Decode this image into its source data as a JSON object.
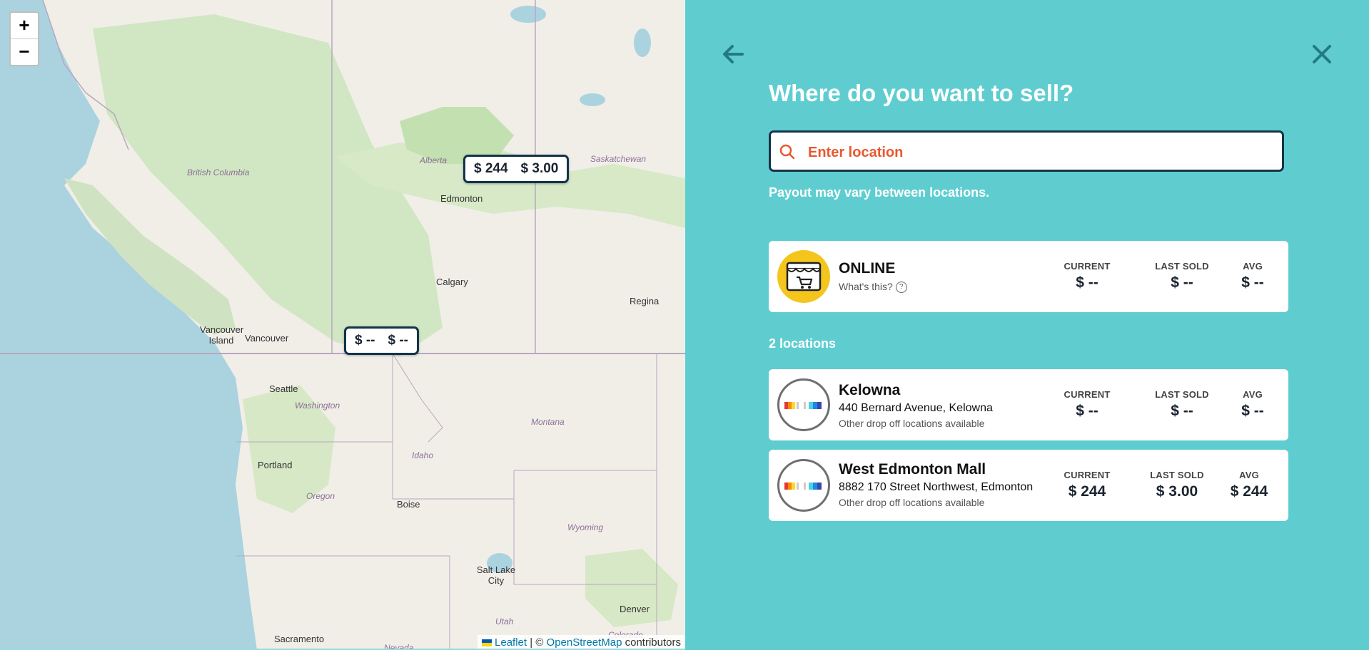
{
  "map": {
    "zoom_in": "+",
    "zoom_out": "−",
    "labels": {
      "british_columbia": "British Columbia",
      "alberta": "Alberta",
      "saskatchewan": "Saskatchewan",
      "edmonton": "Edmonton",
      "calgary": "Calgary",
      "regina": "Regina",
      "vancouver_island": "Vancouver Island",
      "vancouver": "Vancouver",
      "seattle": "Seattle",
      "washington": "Washington",
      "montana": "Montana",
      "portland": "Portland",
      "idaho": "Idaho",
      "oregon": "Oregon",
      "boise": "Boise",
      "wyoming": "Wyoming",
      "salt_lake_city": "Salt Lake City",
      "utah": "Utah",
      "nevada": "Nevada",
      "denver": "Denver",
      "colorado": "Colorado",
      "sacramento": "Sacramento"
    },
    "markers": {
      "edmonton": {
        "current": "$ 244",
        "last_sold": "$ 3.00"
      },
      "kelowna": {
        "current": "$ --",
        "last_sold": "$ --"
      }
    },
    "attribution": {
      "leaflet": "Leaflet",
      "separator": "| ©",
      "osm": "OpenStreetMap",
      "suffix": "contributors"
    }
  },
  "panel": {
    "title": "Where do you want to sell?",
    "search_placeholder": "Enter location",
    "payout_note": "Payout may vary between locations.",
    "location_count": "2 locations",
    "online": {
      "name": "ONLINE",
      "whats_this": "What's this?",
      "help_icon": "?",
      "current_label": "CURRENT",
      "current": "$ --",
      "last_sold_label": "LAST SOLD",
      "last_sold": "$ --",
      "avg_label": "AVG",
      "avg": "$ --"
    },
    "locations": [
      {
        "name": "Kelowna",
        "address": "440 Bernard Avenue, Kelowna",
        "note": "Other drop off locations available",
        "current_label": "CURRENT",
        "current": "$ --",
        "last_sold_label": "LAST SOLD",
        "last_sold": "$ --",
        "avg_label": "AVG",
        "avg": "$ --"
      },
      {
        "name": "West Edmonton Mall",
        "address": "8882 170 Street Northwest, Edmonton",
        "note": "Other drop off locations available",
        "current_label": "CURRENT",
        "current": "$ 244",
        "last_sold_label": "LAST SOLD",
        "last_sold": "$ 3.00",
        "avg_label": "AVG",
        "avg": "$ 244"
      }
    ],
    "colors": {
      "panel_bg": "#5fcdd0",
      "dark_navy": "#163449",
      "accent_orange": "#e8582e",
      "back_arrow": "#237a87"
    }
  }
}
